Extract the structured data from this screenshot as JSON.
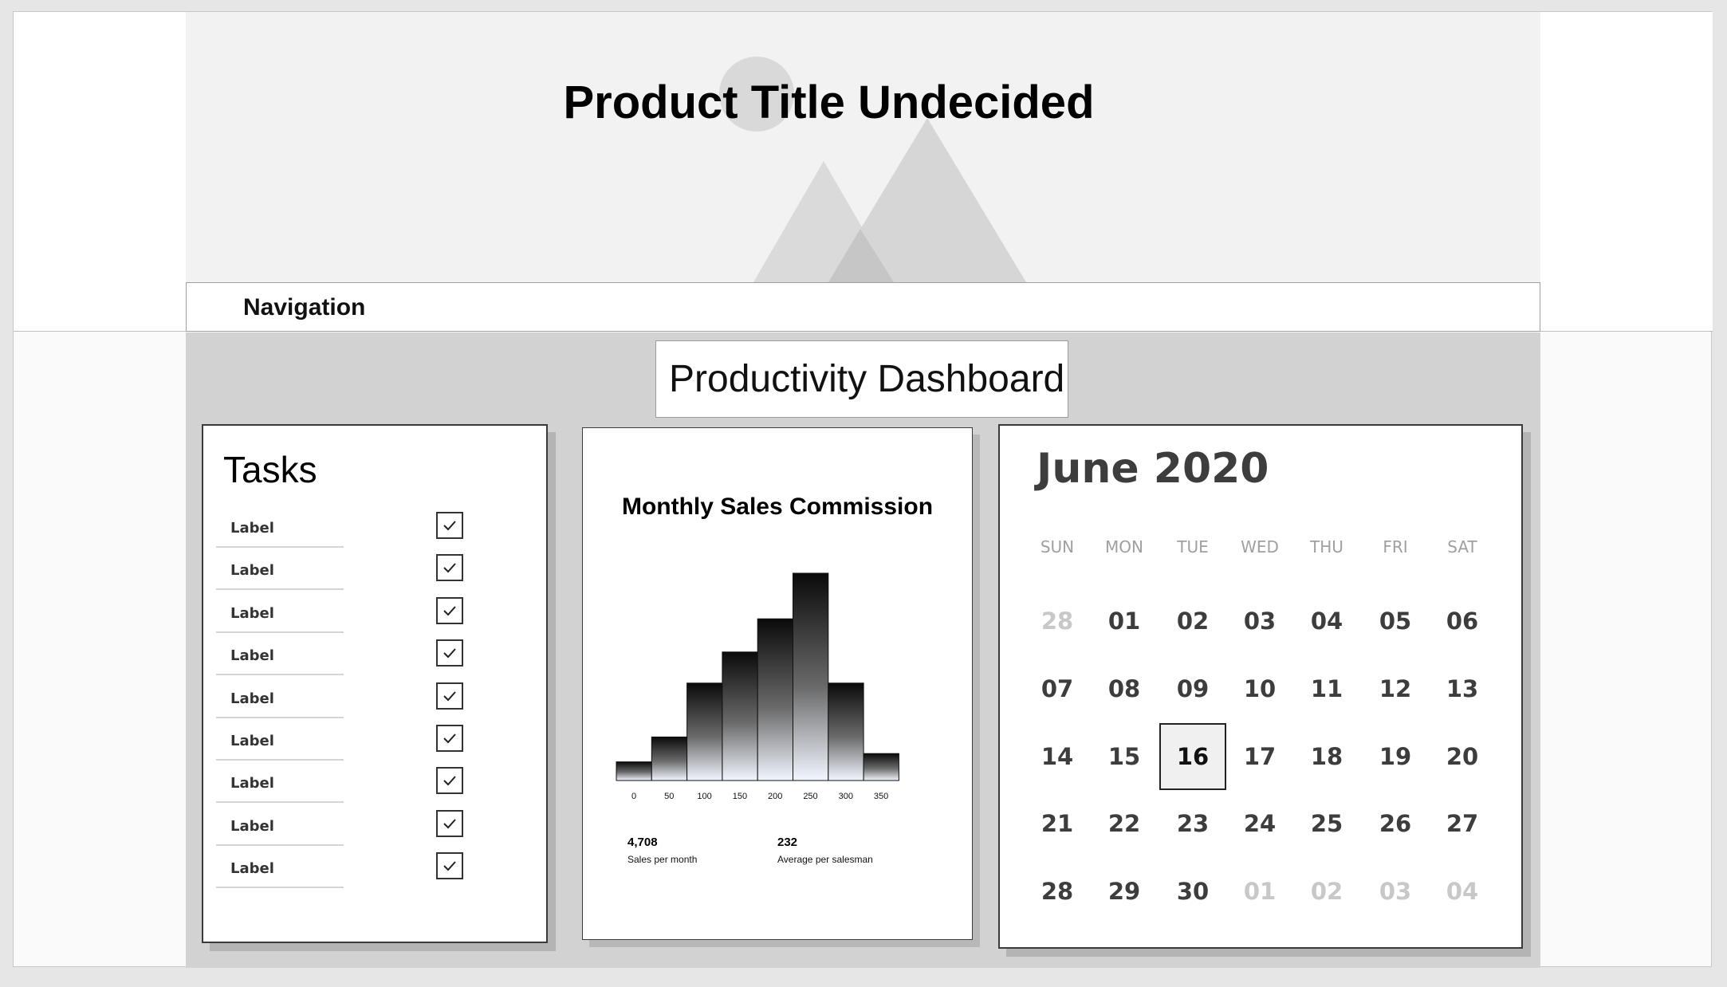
{
  "header": {
    "title": "Product Title Undecided"
  },
  "nav": {
    "label": "Navigation"
  },
  "dashboard": {
    "title": "Productivity Dashboard"
  },
  "tasks": {
    "title": "Tasks",
    "items": [
      {
        "label": "Label",
        "checked": true
      },
      {
        "label": "Label",
        "checked": true
      },
      {
        "label": "Label",
        "checked": true
      },
      {
        "label": "Label",
        "checked": true
      },
      {
        "label": "Label",
        "checked": true
      },
      {
        "label": "Label",
        "checked": true
      },
      {
        "label": "Label",
        "checked": true
      },
      {
        "label": "Label",
        "checked": true
      },
      {
        "label": "Label",
        "checked": true
      }
    ]
  },
  "chart_data": {
    "type": "bar",
    "title": "Monthly Sales Commission",
    "x_ticks": [
      "0",
      "50",
      "100",
      "150",
      "200",
      "250",
      "300",
      "350"
    ],
    "values": [
      9,
      21,
      47,
      62,
      78,
      100,
      47,
      13
    ],
    "stats": [
      {
        "value": "4,708",
        "label": "Sales per month"
      },
      {
        "value": "232",
        "label": "Average per salesman"
      }
    ]
  },
  "calendar": {
    "title": "June 2020",
    "weekdays": [
      "SUN",
      "MON",
      "TUE",
      "WED",
      "THU",
      "FRI",
      "SAT"
    ],
    "weeks": [
      [
        "28",
        "01",
        "02",
        "03",
        "04",
        "05",
        "06"
      ],
      [
        "07",
        "08",
        "09",
        "10",
        "11",
        "12",
        "13"
      ],
      [
        "14",
        "15",
        "16",
        "17",
        "18",
        "19",
        "20"
      ],
      [
        "21",
        "22",
        "23",
        "24",
        "25",
        "26",
        "27"
      ],
      [
        "28",
        "29",
        "30",
        "01",
        "02",
        "03",
        "04"
      ]
    ],
    "selected": "16"
  }
}
